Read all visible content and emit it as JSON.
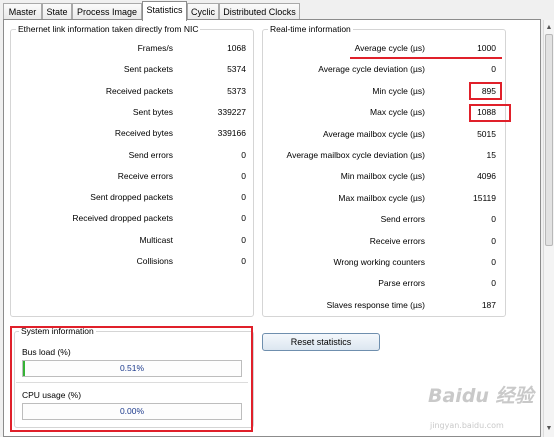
{
  "tabs": [
    {
      "label": "Master",
      "active": false
    },
    {
      "label": "State",
      "active": false
    },
    {
      "label": "Process Image",
      "active": false
    },
    {
      "label": "Statistics",
      "active": true
    },
    {
      "label": "Cyclic",
      "active": false
    },
    {
      "label": "Distributed Clocks",
      "active": false
    }
  ],
  "ethernet": {
    "title": "Ethernet link information taken directly from NIC",
    "rows": [
      {
        "label": "Frames/s",
        "value": "1068"
      },
      {
        "label": "Sent packets",
        "value": "5374"
      },
      {
        "label": "Received packets",
        "value": "5373"
      },
      {
        "label": "Sent bytes",
        "value": "339227"
      },
      {
        "label": "Received bytes",
        "value": "339166"
      },
      {
        "label": "Send errors",
        "value": "0"
      },
      {
        "label": "Receive errors",
        "value": "0"
      },
      {
        "label": "Sent dropped packets",
        "value": "0"
      },
      {
        "label": "Received dropped packets",
        "value": "0"
      },
      {
        "label": "Multicast",
        "value": "0"
      },
      {
        "label": "Collisions",
        "value": "0"
      }
    ]
  },
  "realtime": {
    "title": "Real-time information",
    "rows": [
      {
        "label": "Average cycle (µs)",
        "value": "1000"
      },
      {
        "label": "Average cycle deviation (µs)",
        "value": "0"
      },
      {
        "label": "Min cycle (µs)",
        "value": "895"
      },
      {
        "label": "Max cycle (µs)",
        "value": "1088"
      },
      {
        "label": "Average mailbox cycle (µs)",
        "value": "5015"
      },
      {
        "label": "Average mailbox cycle deviation (µs)",
        "value": "15"
      },
      {
        "label": "Min mailbox cycle (µs)",
        "value": "4096"
      },
      {
        "label": "Max mailbox cycle (µs)",
        "value": "15119"
      },
      {
        "label": "Send errors",
        "value": "0"
      },
      {
        "label": "Receive errors",
        "value": "0"
      },
      {
        "label": "Wrong working counters",
        "value": "0"
      },
      {
        "label": "Parse errors",
        "value": "0"
      },
      {
        "label": "Slaves response time (µs)",
        "value": "187"
      }
    ]
  },
  "reset_button": "Reset statistics",
  "system": {
    "title": "System information",
    "bus_load": {
      "label": "Bus load (%)",
      "text": "0.51%",
      "percent": 0.51
    },
    "cpu_usage": {
      "label": "CPU usage (%)",
      "text": "0.00%",
      "percent": 0.0
    }
  },
  "watermark": {
    "brand": "Baidu 经验",
    "url": "jingyan.baidu.com"
  },
  "colors": {
    "highlight": "#e0202a",
    "progress": "#36b336",
    "percent_text": "#1c3a8c"
  },
  "icons": {
    "scroll_up": "▲",
    "scroll_down": "▼"
  }
}
